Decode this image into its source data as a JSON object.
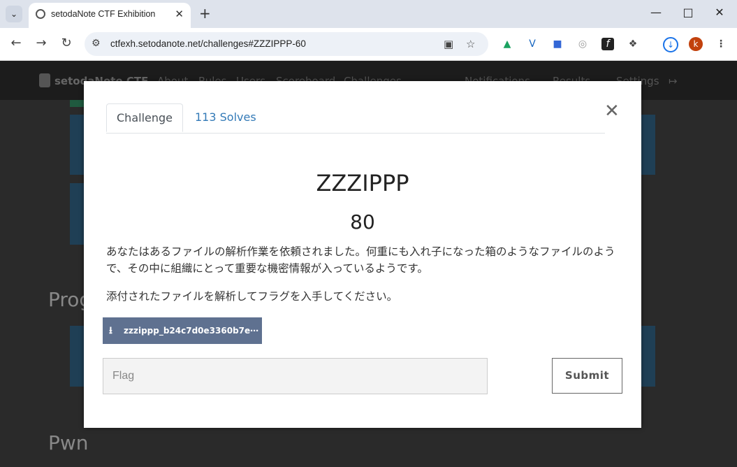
{
  "browser": {
    "tab_title": "setodaNote CTF Exhibition",
    "url": "ctfexh.setodanote.net/challenges#ZZZIPPP-60",
    "avatar_letter": "k"
  },
  "site_nav": {
    "brand": "setodaNote CTF",
    "links": [
      "About",
      "Rules",
      "Users",
      "Scoreboard",
      "Challenges"
    ],
    "right_links": [
      "Notifications",
      "Results",
      "Settings"
    ]
  },
  "sections": [
    "Prog",
    "Pwn"
  ],
  "modal": {
    "tabs": {
      "challenge": "Challenge",
      "solves": "113 Solves"
    },
    "name": "ZZZIPPP",
    "value": "80",
    "description": [
      "あなたはあるファイルの解析作業を依頼されました。何重にも入れ子になった箱のようなファイルのようで、その中に組織にとって重要な機密情報が入っているようです。",
      "添付されたファイルを解析してフラグを入手してください。"
    ],
    "file_label": "zzzippp_b24c7d0e3360b7e⋯",
    "flag_placeholder": "Flag",
    "submit_label": "Submit"
  },
  "colors": {
    "download_bg": "#5f7190",
    "solves_link": "#337ab7"
  }
}
